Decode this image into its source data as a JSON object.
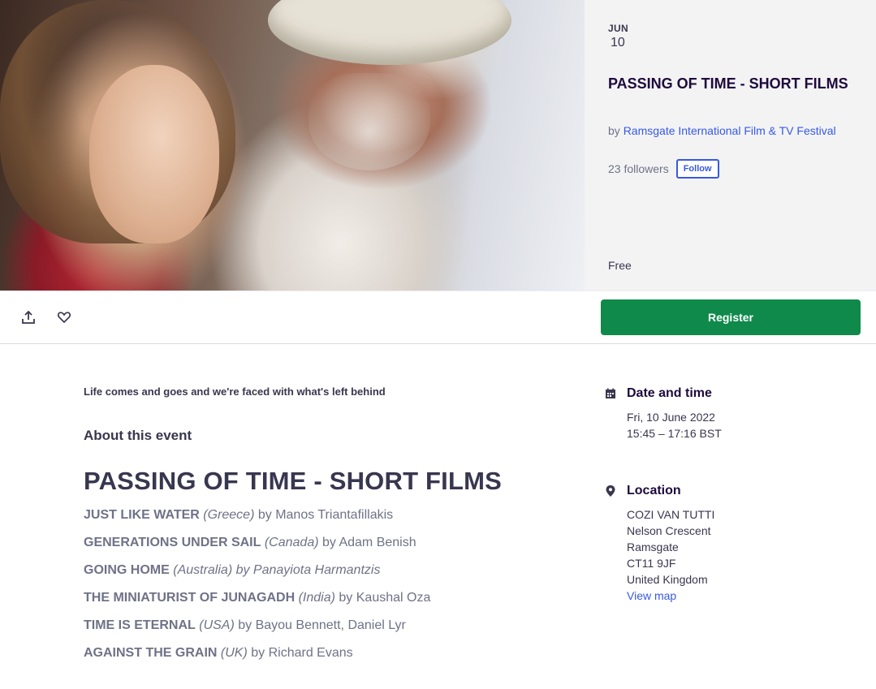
{
  "event": {
    "month": "JUN",
    "day": "10",
    "title": "PASSING OF TIME - SHORT FILMS",
    "by_prefix": "by",
    "organizer": "Ramsgate International Film & TV Festival",
    "followers": "23 followers",
    "follow_label": "Follow",
    "price": "Free",
    "image_icon": "event-photo"
  },
  "actions": {
    "share_icon": "share-icon",
    "like_icon": "heart-icon",
    "register_label": "Register",
    "register_color": "#0f8a4b"
  },
  "content": {
    "summary": "Life comes and goes and we're faced with what's left behind",
    "about_heading": "About this event",
    "films_heading": "PASSING OF TIME - SHORT FILMS",
    "films": [
      {
        "title": "JUST LIKE WATER",
        "country": "(Greece)",
        "by": " by Manos Triantafillakis"
      },
      {
        "title": "GENERATIONS UNDER SAIL",
        "country": "(Canada)",
        "by": " by Adam Benish"
      },
      {
        "title": "GOING HOME",
        "country": "(Australia)",
        "by": " by Panayiota Harmantzis"
      },
      {
        "title": "THE MINIATURIST OF JUNAGADH",
        "country": "(India)",
        "by": " by Kaushal Oza"
      },
      {
        "title": "TIME IS ETERNAL",
        "country": "(USA)",
        "by": " by Bayou Bennett, Daniel Lyr"
      },
      {
        "title": "AGAINST THE GRAIN",
        "country": "(UK)",
        "by": " by Richard Evans"
      }
    ]
  },
  "sidebar": {
    "date_heading": "Date and time",
    "date_icon": "calendar-icon",
    "date_line1": "Fri, 10 June 2022",
    "date_line2": "15:45 – 17:16 BST",
    "location_heading": "Location",
    "location_icon": "location-pin-icon",
    "location_lines": [
      "COZI VAN TUTTI",
      "Nelson Crescent",
      "Ramsgate",
      "CT11 9JF",
      "United Kingdom"
    ],
    "view_map": "View map"
  }
}
